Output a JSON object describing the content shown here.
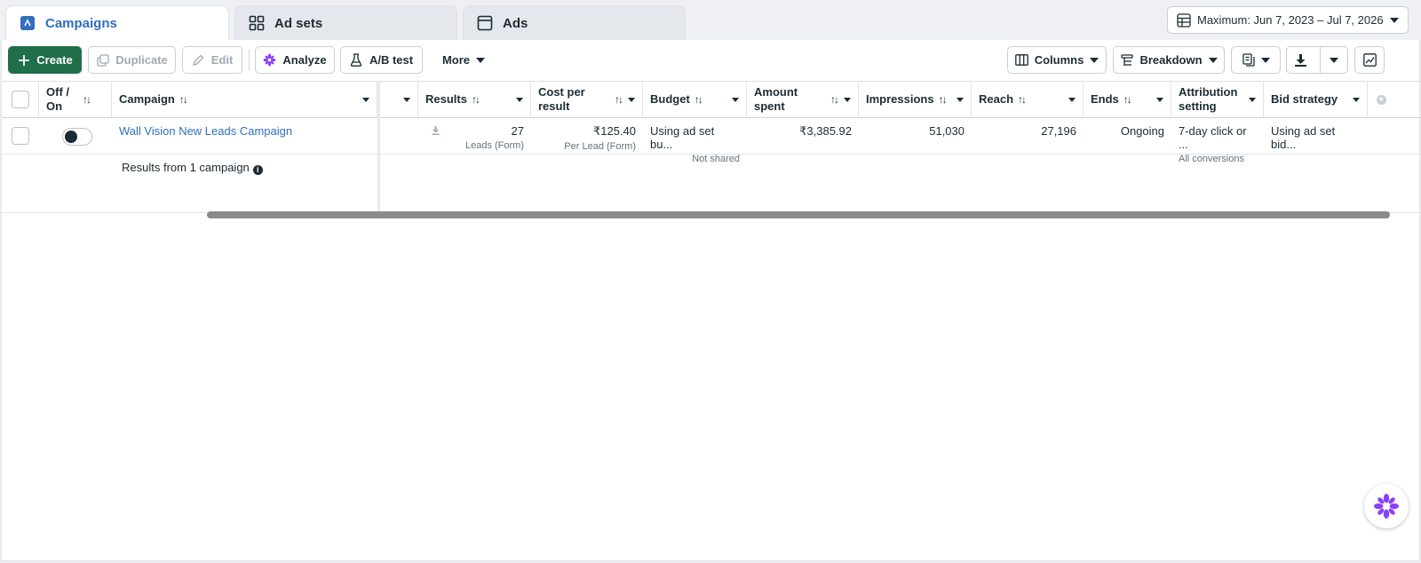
{
  "tabs": [
    {
      "label": "Campaigns",
      "icon": "campaigns-icon",
      "active": true
    },
    {
      "label": "Ad sets",
      "icon": "adsets-grid-icon",
      "active": false
    },
    {
      "label": "Ads",
      "icon": "ads-window-icon",
      "active": false
    }
  ],
  "date_range": {
    "label": "Maximum: Jun 7, 2023 – Jul 7, 2026",
    "icon": "table-calendar-icon"
  },
  "toolbar": {
    "create": "Create",
    "duplicate": "Duplicate",
    "edit": "Edit",
    "analyze": "Analyze",
    "ab_test": "A/B test",
    "more": "More",
    "columns": "Columns",
    "breakdown": "Breakdown"
  },
  "table": {
    "headers": {
      "off_on": "Off / On",
      "campaign": "Campaign",
      "results": "Results",
      "cost_per_result": "Cost per result",
      "budget": "Budget",
      "amount_spent": "Amount spent",
      "impressions": "Impressions",
      "reach": "Reach",
      "ends": "Ends",
      "attribution": "Attribution setting",
      "bid_strategy": "Bid strategy"
    },
    "row": {
      "campaign": "Wall Vision New Leads Campaign",
      "results": "27",
      "results_sub": "Leads (Form)",
      "cost_per_result": "₹125.40",
      "cost_per_result_sub": "Per Lead (Form)",
      "budget": "Using ad set bu...",
      "budget_sub": "Not shared",
      "amount_spent": "₹3,385.92",
      "impressions": "51,030",
      "reach": "27,196",
      "ends": "Ongoing",
      "attribution": "7-day click or ...",
      "attribution_sub": "All conversions",
      "bid_strategy": "Using ad set bid..."
    },
    "totals_label": "Results from 1 campaign"
  },
  "colors": {
    "accent": "#2f6fbe",
    "primary_button": "#216e4b",
    "analyze_icon": "#8a3ffc"
  }
}
